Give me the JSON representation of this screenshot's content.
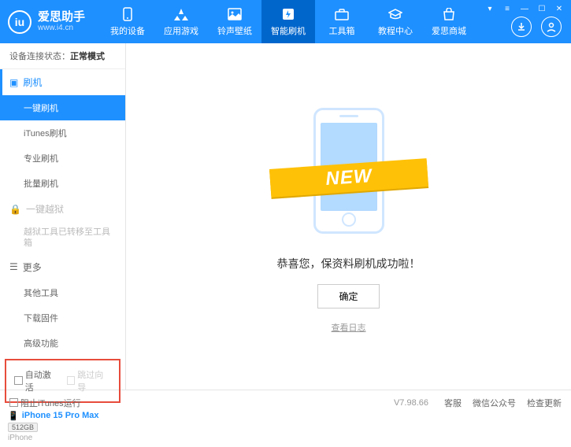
{
  "header": {
    "logoTitle": "爱思助手",
    "logoSub": "www.i4.cn",
    "nav": [
      {
        "label": "我的设备"
      },
      {
        "label": "应用游戏"
      },
      {
        "label": "铃声壁纸"
      },
      {
        "label": "智能刷机"
      },
      {
        "label": "工具箱"
      },
      {
        "label": "教程中心"
      },
      {
        "label": "爱思商城"
      }
    ],
    "activeNav": 3
  },
  "sidebar": {
    "statusLabel": "设备连接状态：",
    "statusValue": "正常模式",
    "group1": "刷机",
    "items1": [
      {
        "label": "一键刷机",
        "active": true
      },
      {
        "label": "iTunes刷机"
      },
      {
        "label": "专业刷机"
      },
      {
        "label": "批量刷机"
      }
    ],
    "group2": "一键越狱",
    "jailbreakNote": "越狱工具已转移至工具箱",
    "group3": "更多",
    "items3": [
      {
        "label": "其他工具"
      },
      {
        "label": "下载固件"
      },
      {
        "label": "高级功能"
      }
    ],
    "chkAuto": "自动激活",
    "chkSkip": "跳过向导",
    "device": {
      "name": "iPhone 15 Pro Max",
      "storage": "512GB",
      "type": "iPhone"
    }
  },
  "main": {
    "ribbon": "NEW",
    "message": "恭喜您，保资料刷机成功啦！",
    "okBtn": "确定",
    "logLink": "查看日志"
  },
  "footer": {
    "blockItunes": "阻止iTunes运行",
    "version": "V7.98.66",
    "links": [
      "客服",
      "微信公众号",
      "检查更新"
    ]
  }
}
